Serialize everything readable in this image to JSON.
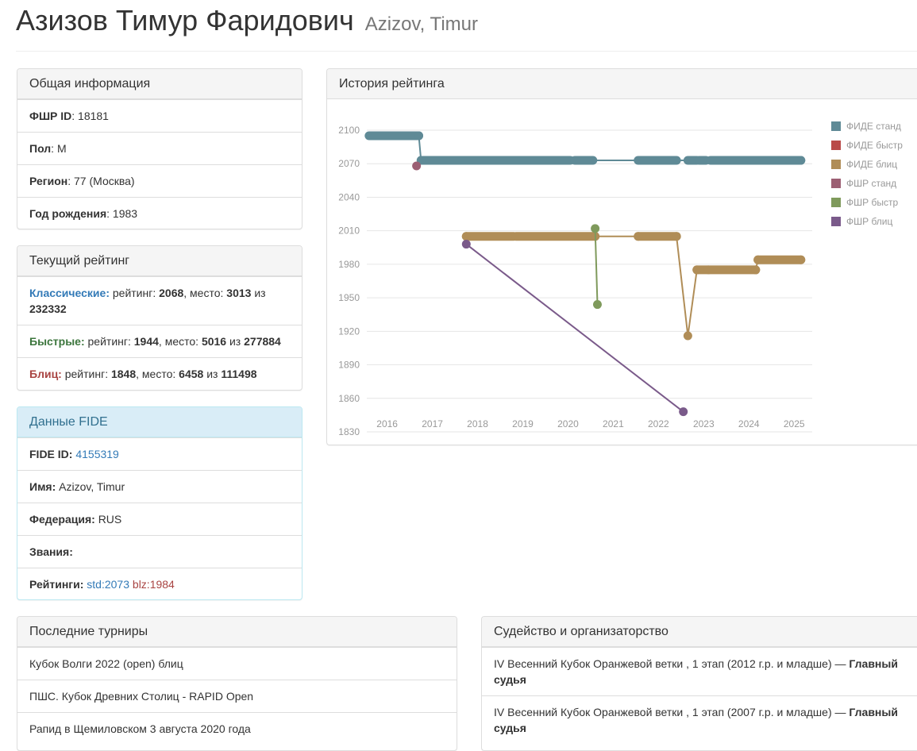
{
  "header": {
    "title_ru": "Азизов Тимур Фаридович",
    "title_en": "Azizov, Timur"
  },
  "general": {
    "heading": "Общая информация",
    "rows": [
      {
        "label": "ФШР ID",
        "value": ": 18181"
      },
      {
        "label": "Пол",
        "value": ": М"
      },
      {
        "label": "Регион",
        "value": ": 77 (Москва)"
      },
      {
        "label": "Год рождения",
        "value": ": 1983"
      }
    ]
  },
  "current": {
    "heading": "Текущий рейтинг",
    "classic": {
      "label": "Классические:",
      "rating_word": " рейтинг: ",
      "rating": "2068",
      "place_word": ", место: ",
      "place": "3013",
      "of": " из ",
      "total": "232332"
    },
    "rapid": {
      "label": "Быстрые:",
      "rating_word": " рейтинг: ",
      "rating": "1944",
      "place_word": ", место: ",
      "place": "5016",
      "of": " из ",
      "total": "277884"
    },
    "blitz": {
      "label": "Блиц:",
      "rating_word": " рейтинг: ",
      "rating": "1848",
      "place_word": ", место: ",
      "place": "6458",
      "of": " из ",
      "total": "111498"
    }
  },
  "fide": {
    "heading": "Данные FIDE",
    "id_label": "FIDE ID:",
    "id_value": "4155319",
    "name_label": "Имя:",
    "name_value": "Azizov, Timur",
    "fed_label": "Федерация:",
    "fed_value": "RUS",
    "titles_label": "Звания:",
    "ratings_label": "Рейтинги:",
    "std": "std:2073",
    "blz": "blz:1984"
  },
  "history": {
    "heading": "История рейтинга"
  },
  "tournaments": {
    "heading": "Последние турниры",
    "items": [
      "Кубок Волги 2022 (open) блиц",
      "ПШС. Кубок Древних Столиц - RAPID Open",
      "Рапид в Щемиловском 3 августа 2020 года"
    ]
  },
  "judging": {
    "heading": "Судейство и организаторство",
    "items": [
      {
        "text": "IV Весенний Кубок Оранжевой ветки , 1 этап (2012 г.р. и младше) — ",
        "role": "Главный судья"
      },
      {
        "text": "IV Весенний Кубок Оранжевой ветки , 1 этап (2007 г.р. и младше) — ",
        "role": "Главный судья"
      }
    ]
  },
  "chart_data": {
    "type": "line",
    "x_ticks": [
      "2016",
      "2017",
      "2018",
      "2019",
      "2020",
      "2021",
      "2022",
      "2023",
      "2024",
      "2025"
    ],
    "y_ticks": [
      2100,
      2070,
      2040,
      2010,
      1980,
      1950,
      1920,
      1890,
      1860,
      1830
    ],
    "ylim": [
      1830,
      2100
    ],
    "xlim": [
      2015.55,
      2025.4
    ],
    "grid": true,
    "legend_position": "right",
    "series": [
      {
        "name": "ФИДЕ станд",
        "color": "#5f8a96",
        "dense": [
          [
            2015.6,
            2016.7,
            2095
          ],
          [
            2016.75,
            2020.05,
            2073
          ],
          [
            2020.15,
            2020.55,
            2073
          ],
          [
            2021.55,
            2022.4,
            2073
          ],
          [
            2022.65,
            2022.85,
            2073
          ],
          [
            2022.9,
            2023.05,
            2073
          ],
          [
            2023.15,
            2025.15,
            2073
          ]
        ],
        "points": [
          [
            2016.7,
            2095
          ],
          [
            2016.75,
            2073
          ],
          [
            2025.15,
            2073
          ]
        ]
      },
      {
        "name": "ФИДЕ быстр",
        "color": "#b94a48",
        "dense": [],
        "points": []
      },
      {
        "name": "ФИДЕ блиц",
        "color": "#b08d57",
        "dense": [
          [
            2017.75,
            2018.8,
            2005
          ],
          [
            2018.85,
            2020.6,
            2005
          ],
          [
            2021.55,
            2022.4,
            2005
          ],
          [
            2022.85,
            2023.1,
            1975
          ],
          [
            2023.1,
            2024.15,
            1975
          ],
          [
            2024.2,
            2025.15,
            1984
          ]
        ],
        "points": [
          [
            2017.75,
            2005
          ],
          [
            2020.6,
            2005
          ],
          [
            2021.55,
            2005
          ],
          [
            2022.4,
            2005
          ],
          [
            2022.65,
            1916
          ],
          [
            2022.85,
            1975
          ],
          [
            2024.15,
            1975
          ],
          [
            2024.2,
            1984
          ],
          [
            2025.15,
            1984
          ]
        ]
      },
      {
        "name": "ФШР станд",
        "color": "#9c5f73",
        "dense": [],
        "points": [
          [
            2016.65,
            2068
          ]
        ]
      },
      {
        "name": "ФШР быстр",
        "color": "#7f9a5c",
        "dense": [],
        "points": [
          [
            2020.6,
            2012
          ],
          [
            2020.65,
            1944
          ]
        ]
      },
      {
        "name": "ФШР блиц",
        "color": "#7a5a8a",
        "dense": [],
        "points": [
          [
            2017.75,
            1998
          ],
          [
            2022.55,
            1848
          ]
        ]
      }
    ]
  }
}
